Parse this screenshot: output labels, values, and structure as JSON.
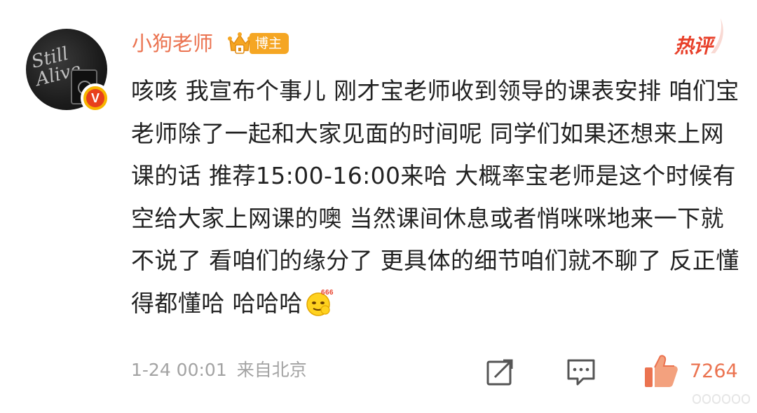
{
  "comment": {
    "username": "小狗老师",
    "role_badge": "博主",
    "hot_label": "热评",
    "avatar_text": "Still Alive",
    "verified_badge": "V",
    "text": "咳咳 我宣布个事儿 刚才宝老师收到领导的课表安排 咱们宝老师除了一起和大家见面的时间呢 同学们如果还想来上网课的话 推荐15:00-16:00来哈 大概率宝老师是这个时候有空给大家上网课的噢 当然课间休息或者悄咪咪地来一下就不说了 看咱们的缘分了 更具体的细节咱们就不聊了 反正懂得都懂哈 哈哈哈",
    "emoji": "666-emoji-icon",
    "emoji_text": "666",
    "time": "1-24 00:01",
    "source": "来自北京",
    "like_count": "7264"
  },
  "colors": {
    "username": "#eb7350",
    "badge": "#f5a623",
    "hot": "#e8402a",
    "text": "#222222",
    "meta": "#a3a3a3",
    "like": "#eb7350"
  }
}
